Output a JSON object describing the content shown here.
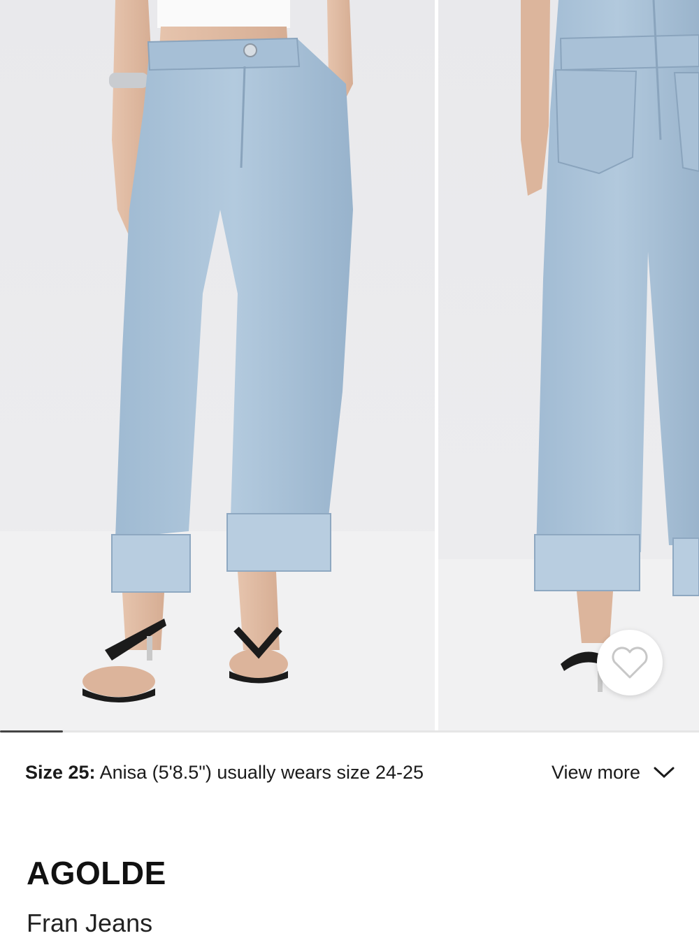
{
  "gallery": {
    "images": [
      {
        "alt": "Front view of light wash cuffed jeans"
      },
      {
        "alt": "Back view of light wash cuffed jeans"
      }
    ],
    "progress": 0.09
  },
  "fit_info": {
    "size_label": "Size 25:",
    "description": "Anisa (5'8.5\") usually wears size 24-25",
    "view_more_label": "View more"
  },
  "product": {
    "brand": "AGOLDE",
    "name": "Fran Jeans"
  },
  "icons": {
    "wishlist": "heart-icon",
    "view_more": "chevron-down-icon"
  },
  "colors": {
    "denim": "#a9c3d9",
    "background": "#ececee",
    "text": "#1a1a1a"
  }
}
